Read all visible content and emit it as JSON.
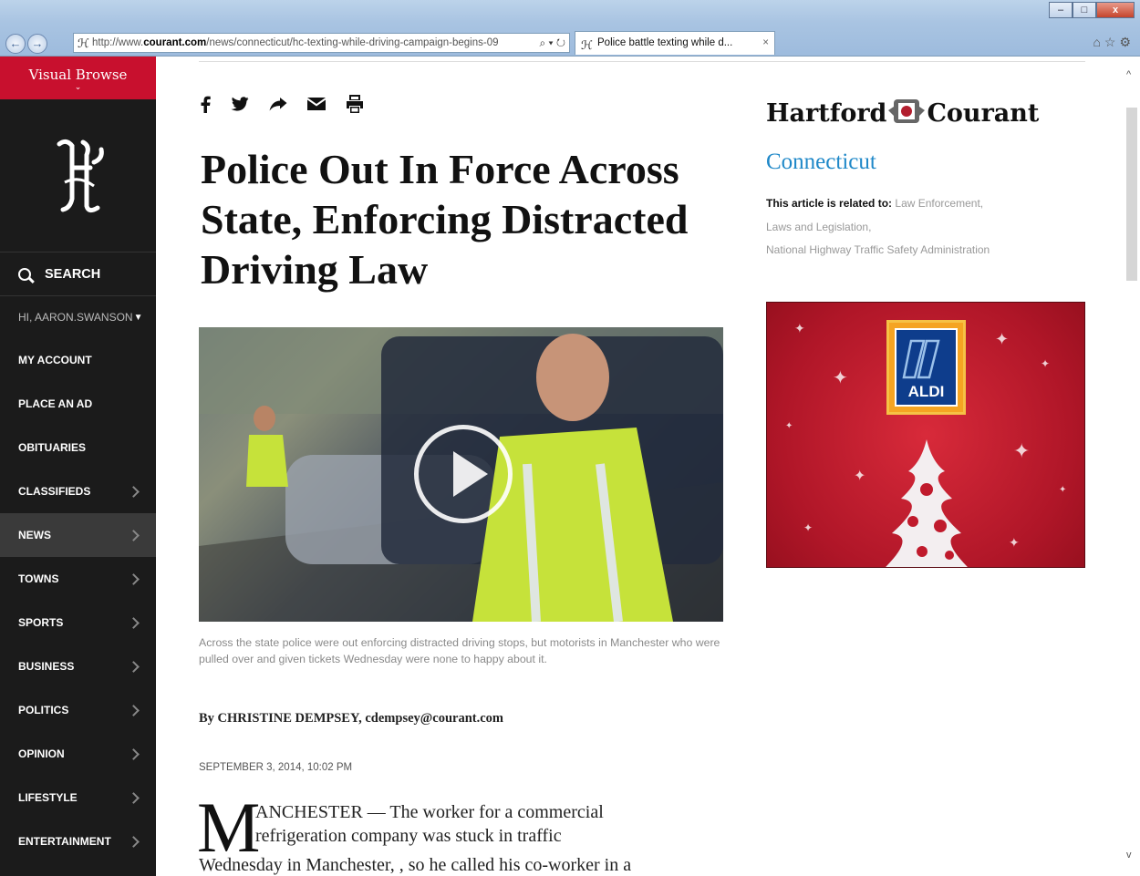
{
  "browser": {
    "url_prefix": "http://www.",
    "url_domain": "courant.com",
    "url_rest": "/news/connecticut/hc-texting-while-driving-campaign-begins-09",
    "tab_title": "Police battle texting while d...",
    "tab_close": "×",
    "right_tools": "⌂☆⚙",
    "window_min": "–",
    "window_max": "□",
    "window_close": "x",
    "back": "←",
    "forward": "→",
    "search_refresh": "⌕ ▾ ↻"
  },
  "sidebar": {
    "visual_browse": "Visual Browse",
    "visual_browse_chevron": "⌄",
    "search_label": "SEARCH",
    "user_greeting": "HI, AARON.SWANSON",
    "user_caret": "▼",
    "items": [
      {
        "label": "MY ACCOUNT"
      },
      {
        "label": "PLACE AN AD"
      },
      {
        "label": "OBITUARIES"
      },
      {
        "label": "CLASSIFIEDS"
      },
      {
        "label": "NEWS"
      },
      {
        "label": "TOWNS"
      },
      {
        "label": "SPORTS"
      },
      {
        "label": "BUSINESS"
      },
      {
        "label": "POLITICS"
      },
      {
        "label": "OPINION"
      },
      {
        "label": "LIFESTYLE"
      },
      {
        "label": "ENTERTAINMENT"
      }
    ]
  },
  "article": {
    "headline": "Police Out In Force Across State, Enforcing Distracted Driving Law",
    "caption": "Across the state police were out enforcing distracted driving stops, but motorists in Manchester who were pulled over and given tickets Wednesday were none to happy about it.",
    "byline": "By  CHRISTINE DEMPSEY, cdempsey@courant.com",
    "date": "SEPTEMBER 3, 2014, 10:02 PM",
    "dropcap": "M",
    "body_line1": "ANCHESTER — The worker for a commercial",
    "body_line2": "refrigeration company was stuck in traffic",
    "body_line3": "Wednesday in Manchester, , so he called his co-worker in a"
  },
  "right": {
    "masthead_left": "Hartford",
    "masthead_right": "Courant",
    "section": "Connecticut",
    "related_label": "This article is related to:",
    "related_1": "Law Enforcement,",
    "related_2": "Laws and Legislation,",
    "related_3": "National Highway Traffic Safety Administration",
    "ad_brand": "ALDI"
  },
  "colors": {
    "sidebar_bg": "#1b1b1b",
    "visual_browse_red": "#c8102e",
    "section_blue": "#1f88c8",
    "ad_red": "#c01a2c"
  }
}
